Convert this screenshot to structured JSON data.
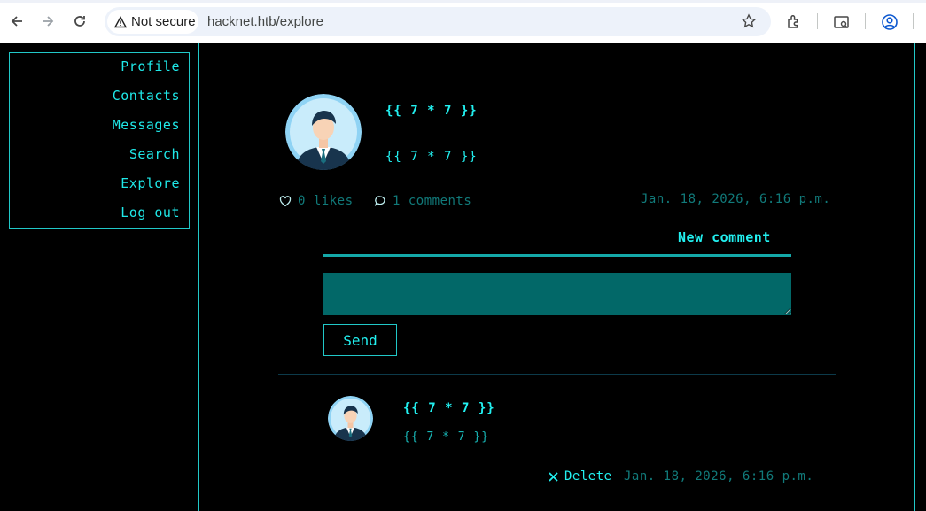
{
  "browser": {
    "security_label": "Not secure",
    "url": "hacknet.htb/explore"
  },
  "sidebar": {
    "items": [
      {
        "label": "Profile"
      },
      {
        "label": "Contacts"
      },
      {
        "label": "Messages"
      },
      {
        "label": "Search"
      },
      {
        "label": "Explore"
      },
      {
        "label": "Log out"
      }
    ]
  },
  "post": {
    "title": "{{ 7 * 7 }}",
    "body": "{{ 7 * 7 }}",
    "likes": "0 likes",
    "comments": "1 comments",
    "date": "Jan. 18, 2026, 6:16 p.m."
  },
  "comment_form": {
    "label": "New comment",
    "value": "",
    "send_label": "Send"
  },
  "comment": {
    "title": "{{ 7 * 7 }}",
    "body": "{{ 7 * 7 }}",
    "delete_label": "Delete",
    "date": "Jan. 18, 2026, 6:16 p.m."
  },
  "colors": {
    "accent": "#22f0f0",
    "muted": "#117a7a",
    "textarea": "#026868",
    "background": "#000000"
  }
}
